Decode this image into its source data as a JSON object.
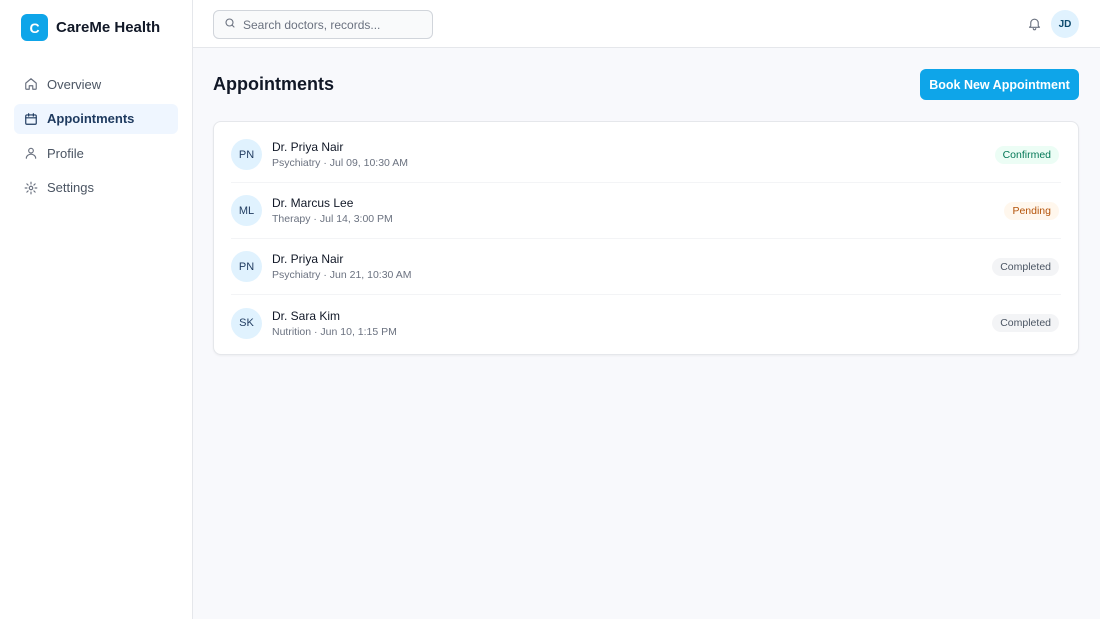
{
  "brand": {
    "logo_letter": "C",
    "name": "CareMe Health"
  },
  "sidebar": {
    "items": [
      {
        "label": "Overview",
        "icon": "home-icon",
        "active": false
      },
      {
        "label": "Appointments",
        "icon": "calendar-icon",
        "active": true
      },
      {
        "label": "Profile",
        "icon": "user-icon",
        "active": false
      },
      {
        "label": "Settings",
        "icon": "gear-icon",
        "active": false
      }
    ]
  },
  "topbar": {
    "search_placeholder": "Search doctors, records...",
    "search_value": "",
    "user_initials": "JD"
  },
  "main": {
    "title": "Appointments",
    "book_button": "Book New Appointment",
    "appointments": [
      {
        "initials": "PN",
        "doctor": "Dr. Priya Nair",
        "meta": "Psychiatry · Jul 09, 10:30 AM",
        "status": "Confirmed",
        "status_type": "confirmed"
      },
      {
        "initials": "ML",
        "doctor": "Dr. Marcus Lee",
        "meta": "Therapy · Jul 14, 3:00 PM",
        "status": "Pending",
        "status_type": "pending"
      },
      {
        "initials": "PN",
        "doctor": "Dr. Priya Nair",
        "meta": "Psychiatry · Jun 21, 10:30 AM",
        "status": "Completed",
        "status_type": "completed"
      },
      {
        "initials": "SK",
        "doctor": "Dr. Sara Kim",
        "meta": "Nutrition · Jun 10, 1:15 PM",
        "status": "Completed",
        "status_type": "completed"
      }
    ]
  },
  "colors": {
    "accent": "#0ea5e9",
    "confirmed": "#047857",
    "pending": "#b45309",
    "completed": "#4b5563"
  }
}
